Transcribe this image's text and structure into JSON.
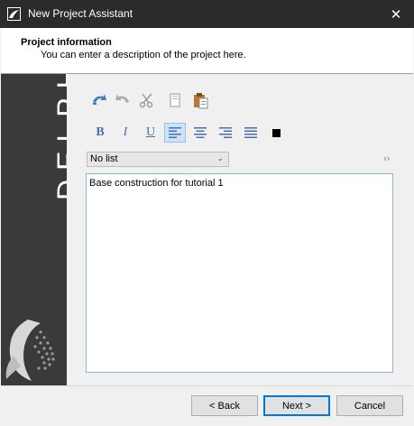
{
  "window": {
    "title": "New Project Assistant",
    "close_glyph": "✕"
  },
  "header": {
    "title": "Project information",
    "subtitle": "You can enter a description of the project here."
  },
  "sidebar": {
    "brand": "DELPHIN"
  },
  "toolbar": {
    "icons": [
      "undo-icon",
      "redo-icon",
      "cut-icon",
      "copy-icon",
      "paste-icon"
    ],
    "bold": "B",
    "italic": "I",
    "underline": "U",
    "text_color": "#000000"
  },
  "list_style": {
    "selected": "No list",
    "expand_glyph": "››"
  },
  "editor": {
    "content": "Base construction for tutorial 1"
  },
  "buttons": {
    "back": "< Back",
    "next": "Next >",
    "cancel": "Cancel"
  },
  "colors": {
    "accent": "#0078d7",
    "titlebar": "#2b2b2b",
    "sidebar": "#3a3a3a"
  }
}
